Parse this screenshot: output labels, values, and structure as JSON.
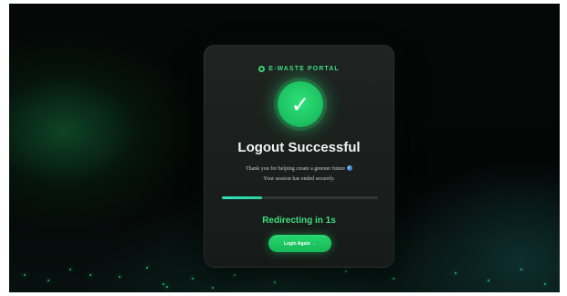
{
  "brand": {
    "icon": "recycle-icon",
    "label": "E-WASTE PORTAL"
  },
  "status": {
    "icon": "checkmark-icon",
    "glyph": "✓",
    "title": "Logout Successful",
    "message_line1": "Thank you for helping create a greener future",
    "message_icon": "globe-icon",
    "message_line2": "Your session has ended securely."
  },
  "progress": {
    "percent": 26
  },
  "redirect": {
    "text": "Redirecting in 1s"
  },
  "actions": {
    "login_again_label": "Login Again →"
  },
  "colors": {
    "accent": "#3ddc84",
    "button": "#1ec463",
    "progress": "#2fe3c2",
    "background": "#050807",
    "card": "#1b1f1d"
  }
}
